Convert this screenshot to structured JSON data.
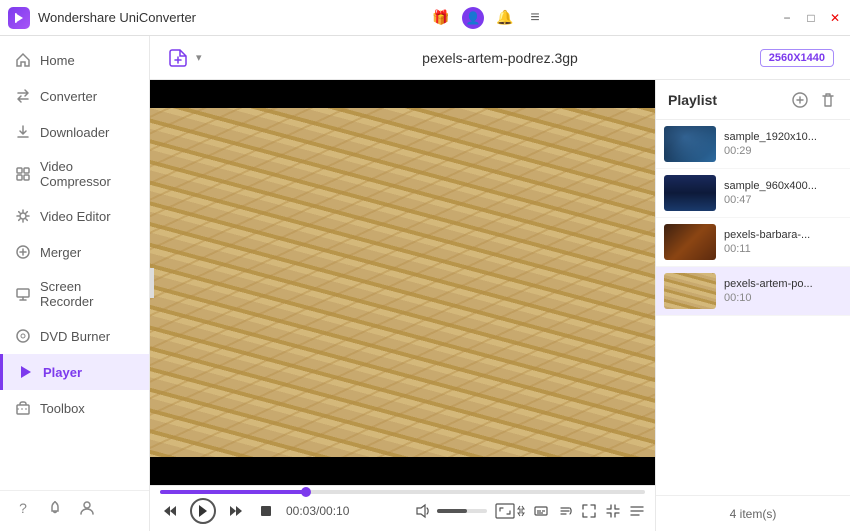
{
  "app": {
    "title": "Wondershare UniConverter",
    "logo_text": "W"
  },
  "titlebar": {
    "title": "Wondershare UniConverter",
    "icons": {
      "gift": "🎁",
      "profile": "👤",
      "bell": "🔔",
      "menu": "≡",
      "minimize": "−",
      "maximize": "□",
      "close": "✕"
    }
  },
  "sidebar": {
    "items": [
      {
        "id": "home",
        "label": "Home",
        "icon": "⌂"
      },
      {
        "id": "converter",
        "label": "Converter",
        "icon": "⇄"
      },
      {
        "id": "downloader",
        "label": "Downloader",
        "icon": "↓"
      },
      {
        "id": "video-compressor",
        "label": "Video Compressor",
        "icon": "⊞"
      },
      {
        "id": "video-editor",
        "label": "Video Editor",
        "icon": "✦"
      },
      {
        "id": "merger",
        "label": "Merger",
        "icon": "⊕"
      },
      {
        "id": "screen-recorder",
        "label": "Screen Recorder",
        "icon": "▣"
      },
      {
        "id": "dvd-burner",
        "label": "DVD Burner",
        "icon": "◎"
      },
      {
        "id": "player",
        "label": "Player",
        "icon": "▶",
        "active": true
      },
      {
        "id": "toolbox",
        "label": "Toolbox",
        "icon": "⚙"
      }
    ],
    "bottom_icons": [
      "?",
      "🔔",
      "☺"
    ]
  },
  "topbar": {
    "add_btn_label": "+",
    "filename": "pexels-artem-podrez.3gp",
    "resolution": "2560X1440"
  },
  "controls": {
    "time_current": "00:03",
    "time_total": "00:10",
    "time_display": "00:03/00:10"
  },
  "playlist": {
    "title": "Playlist",
    "footer_text": "4 item(s)",
    "items": [
      {
        "id": 1,
        "name": "sample_1920x10...",
        "duration": "00:29",
        "thumb": "1",
        "active": false
      },
      {
        "id": 2,
        "name": "sample_960x400...",
        "duration": "00:47",
        "thumb": "2",
        "active": false
      },
      {
        "id": 3,
        "name": "pexels-barbara-...",
        "duration": "00:11",
        "thumb": "3",
        "active": false
      },
      {
        "id": 4,
        "name": "pexels-artem-po...",
        "duration": "00:10",
        "thumb": "4",
        "active": true
      }
    ]
  }
}
